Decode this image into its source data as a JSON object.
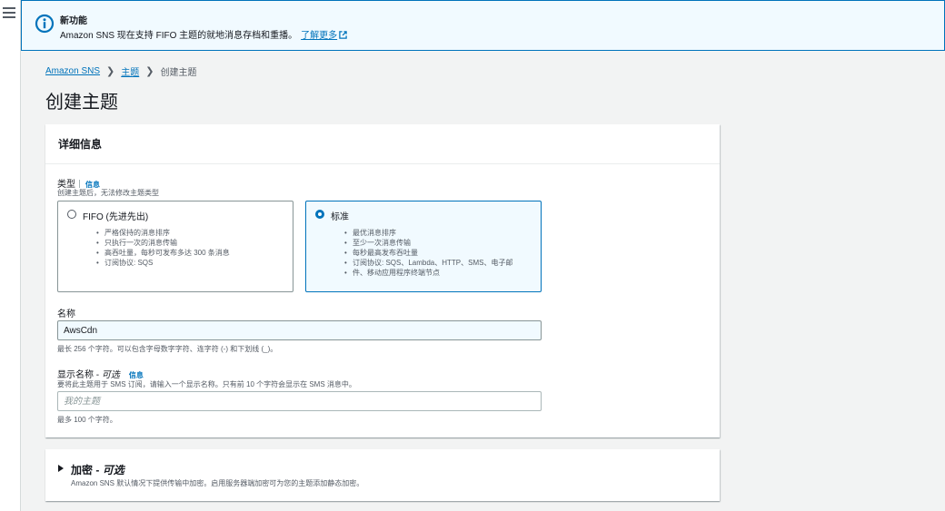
{
  "flash": {
    "title": "新功能",
    "message": "Amazon SNS 现在支持 FIFO 主题的就地消息存档和重播。",
    "link": "了解更多"
  },
  "breadcrumb": {
    "items": [
      "Amazon SNS",
      "主题"
    ],
    "current": "创建主题"
  },
  "page": {
    "title": "创建主题"
  },
  "details": {
    "header": "详细信息",
    "type": {
      "label": "类型",
      "info": "信息",
      "description": "创建主题后，无法修改主题类型",
      "options": [
        {
          "title": "FIFO (先进先出)",
          "selected": false,
          "bullets": [
            "严格保持的消息排序",
            "只执行一次的消息传输",
            "高吞吐量，每秒可发布多达 300 条消息",
            "订阅协议: SQS"
          ]
        },
        {
          "title": "标准",
          "selected": true,
          "bullets": [
            "最优消息排序",
            "至少一次消息传输",
            "每秒最高发布吞吐量",
            "订阅协议: SQS、Lambda、HTTP、SMS、电子邮",
            "件、移动应用程序终端节点"
          ]
        }
      ]
    },
    "name": {
      "label": "名称",
      "value": "AwsCdn",
      "hint": "最长 256 个字符。可以包含字母数字字符、连字符 (-) 和下划线 (_)。"
    },
    "display_name": {
      "label": "显示名称",
      "optional": "可选",
      "info": "信息",
      "description": "要将此主题用于 SMS 订阅，请输入一个显示名称。只有前 10 个字符会显示在 SMS 消息中。",
      "placeholder": "我的主题",
      "hint": "最多 100 个字符。"
    }
  },
  "encryption": {
    "title": "加密",
    "optional": "可选",
    "description": "Amazon SNS 默认情况下提供传输中加密。启用服务器端加密可为您的主题添加静态加密。"
  },
  "colors": {
    "accent": "#0073bb",
    "selected_bg": "#f1faff",
    "background": "#f2f3f3"
  }
}
